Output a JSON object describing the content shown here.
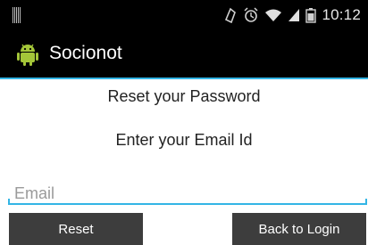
{
  "status_bar": {
    "time": "10:12",
    "icons": [
      "notification-icon",
      "alarm-icon",
      "wifi-icon",
      "signal-icon",
      "battery-icon"
    ]
  },
  "action_bar": {
    "title": "Socionot",
    "icon": "android-icon",
    "accent_color": "#33b5e5"
  },
  "form": {
    "title": "Reset your Password",
    "email_prompt": "Enter your Email Id",
    "email_placeholder": "Email",
    "email_value": "",
    "reset_label": "Reset",
    "back_label": "Back to Login"
  }
}
